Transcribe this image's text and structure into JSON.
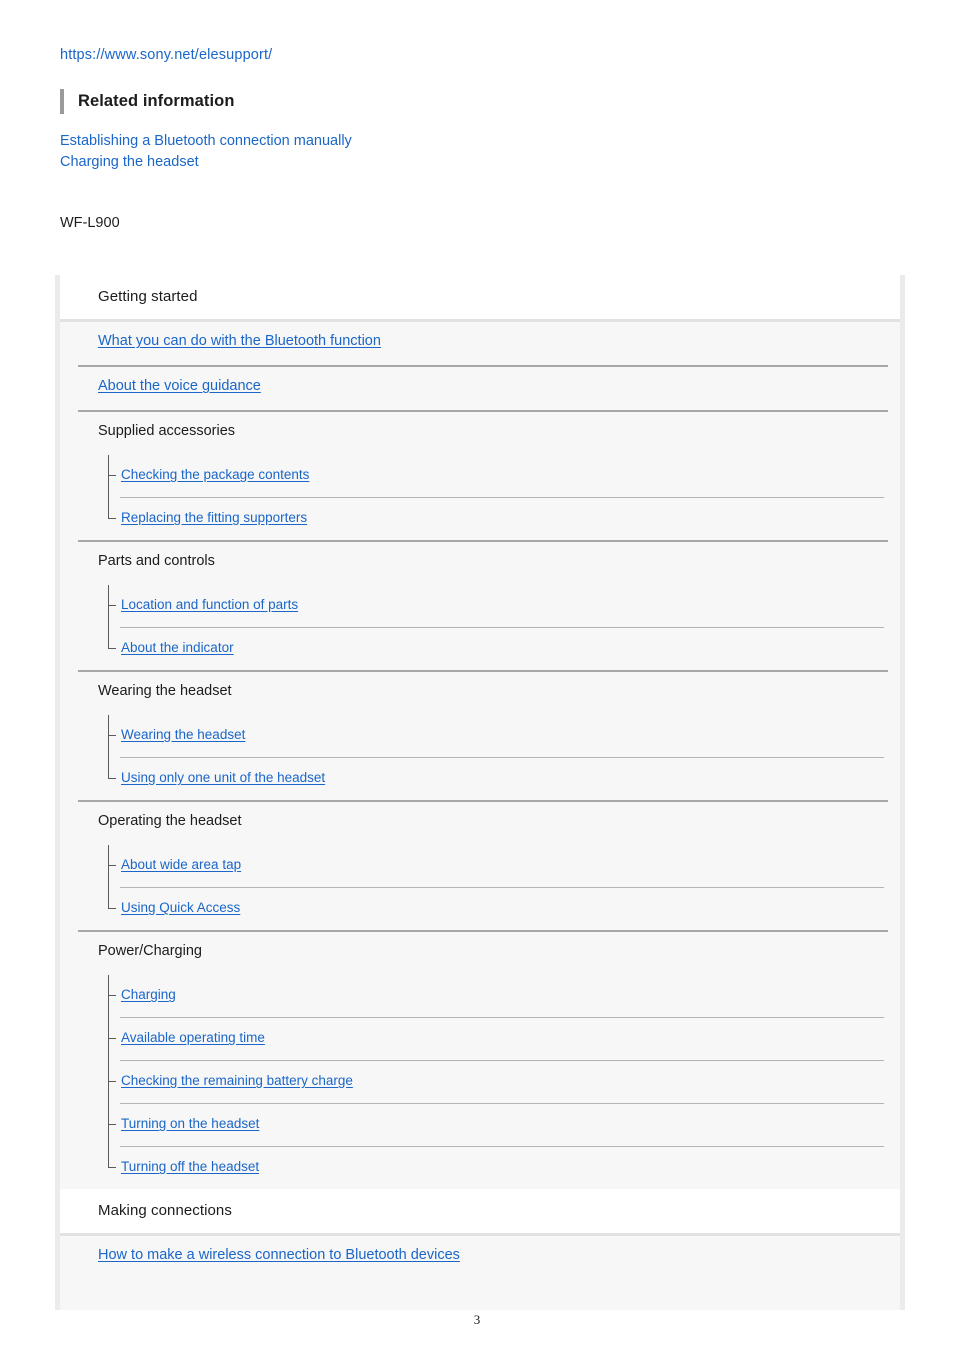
{
  "header": {
    "url": "https://www.sony.net/elesupport/",
    "related_title": "Related information",
    "related_links": [
      "Establishing a Bluetooth connection manually",
      "Charging the headset"
    ],
    "model": "WF-L900"
  },
  "page_number": "3",
  "colors": {
    "link": "#1a66c9",
    "text": "#1c1c1c",
    "frame": "#ebebeb",
    "panel": "#f7f7f7",
    "header_bar": "#ffffff",
    "divider_major": "#a8a8a8",
    "divider_minor": "#b4b4b4",
    "tree_line": "#5a5a5a",
    "heading_bar": "#9a9a9a"
  },
  "toc": {
    "sections": [
      {
        "title": "Getting started",
        "entries": [
          {
            "kind": "link",
            "label": "What you can do with the Bluetooth function"
          },
          {
            "kind": "link",
            "label": "About the voice guidance"
          },
          {
            "kind": "group",
            "label": "Supplied accessories",
            "children": [
              "Checking the package contents",
              "Replacing the fitting supporters"
            ]
          },
          {
            "kind": "group",
            "label": "Parts and controls",
            "children": [
              "Location and function of parts",
              "About the indicator"
            ]
          },
          {
            "kind": "group",
            "label": "Wearing the headset",
            "children": [
              "Wearing the headset",
              "Using only one unit of the headset"
            ]
          },
          {
            "kind": "group",
            "label": "Operating the headset",
            "children": [
              "About wide area tap",
              "Using Quick Access"
            ]
          },
          {
            "kind": "group",
            "label": "Power/Charging",
            "children": [
              "Charging",
              "Available operating time",
              "Checking the remaining battery charge",
              "Turning on the headset",
              "Turning off the headset"
            ]
          }
        ]
      },
      {
        "title": "Making connections",
        "entries": [
          {
            "kind": "link",
            "label": "How to make a wireless connection to Bluetooth devices"
          }
        ]
      }
    ]
  }
}
